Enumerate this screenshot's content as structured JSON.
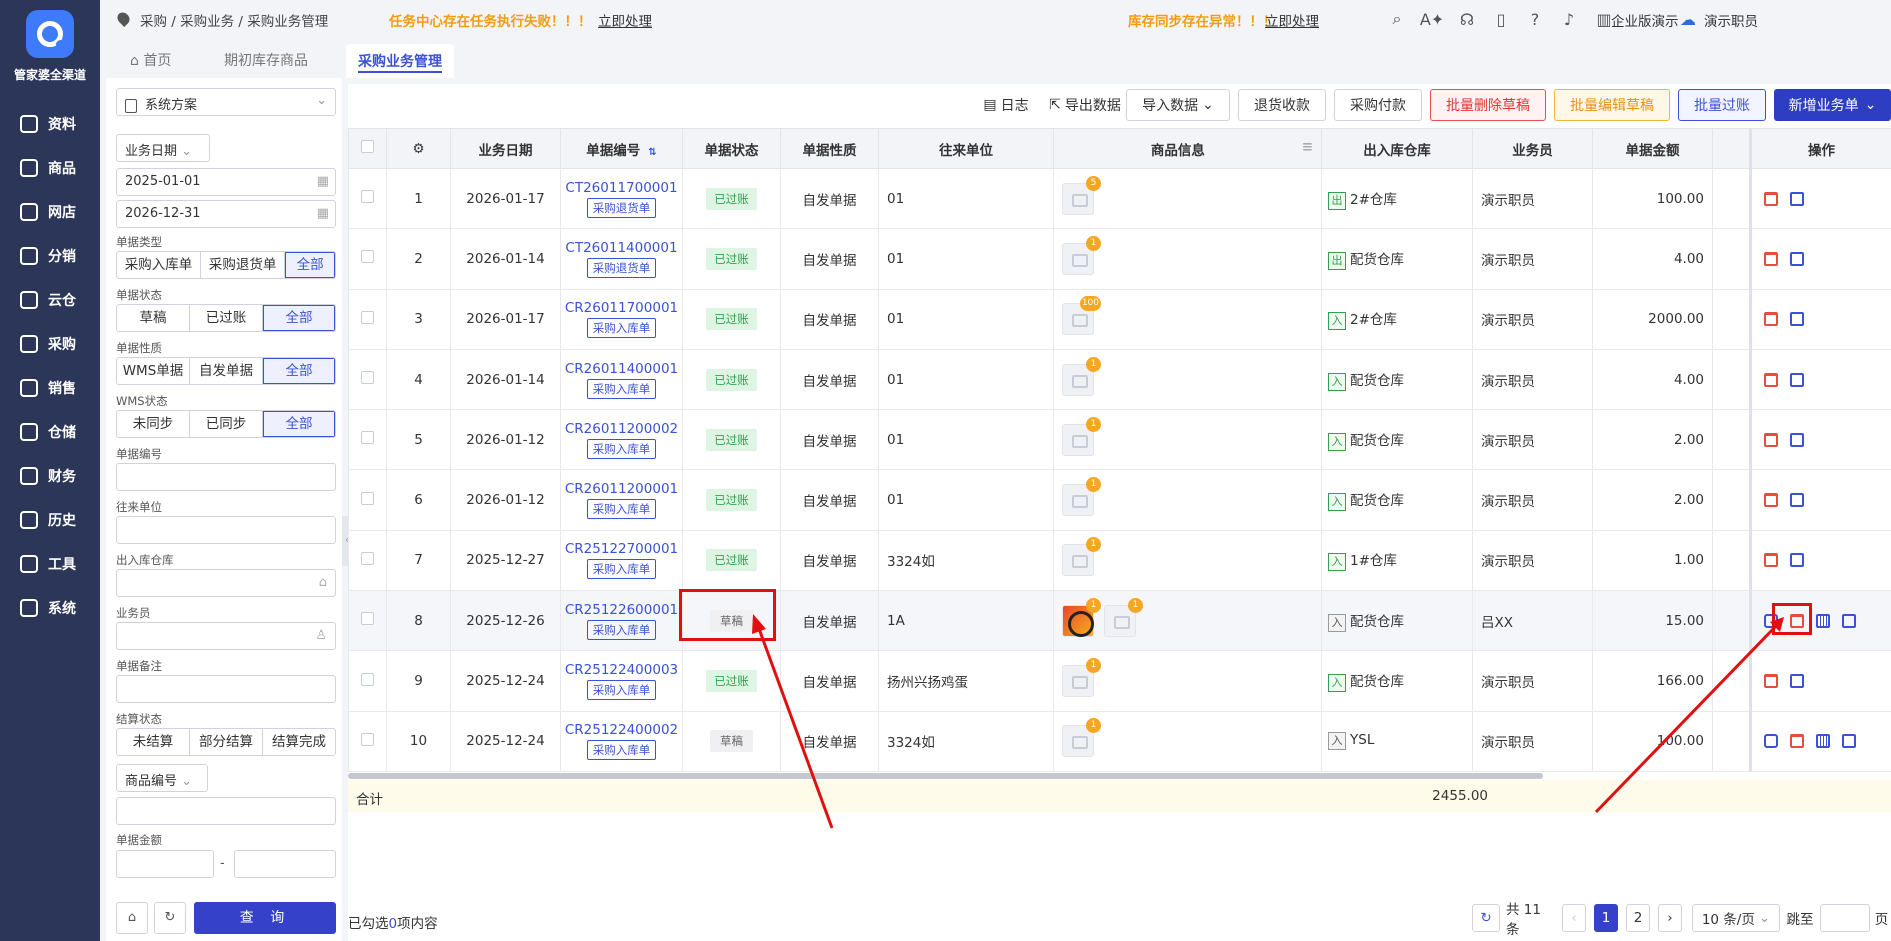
{
  "brand": "管家婆全渠道",
  "nav": [
    "资料",
    "商品",
    "网店",
    "分销",
    "云仓",
    "采购",
    "销售",
    "仓储",
    "财务",
    "历史",
    "工具",
    "系统"
  ],
  "topbar": {
    "breadcrumb": "采购 / 采购业务 / 采购业务管理",
    "warning1": "任务中心存在任务执行失败！！！",
    "warning1_link": "立即处理",
    "warning2": "库存同步存在异常！！！",
    "warning2_link": "立即处理",
    "edition": "企业版演示",
    "user": "演示职员"
  },
  "tabs": [
    "首页",
    "期初库存商品",
    "采购业务管理"
  ],
  "filter": {
    "scheme": "系统方案",
    "date_type": "业务日期",
    "date_from": "2025-01-01",
    "date_to": "2026-12-31",
    "doc_type_label": "单据类型",
    "doc_type_options": [
      "采购入库单",
      "采购退货单",
      "全部"
    ],
    "doc_status_label": "单据状态",
    "doc_status_options": [
      "草稿",
      "已过账",
      "全部"
    ],
    "doc_nature_label": "单据性质",
    "doc_nature_options": [
      "WMS单据",
      "自发单据",
      "全部"
    ],
    "wms_label": "WMS状态",
    "wms_options": [
      "未同步",
      "已同步",
      "全部"
    ],
    "doc_no_label": "单据编号",
    "partner_label": "往来单位",
    "warehouse_label": "出入库仓库",
    "staff_label": "业务员",
    "remark_label": "单据备注",
    "settle_label": "结算状态",
    "settle_options": [
      "未结算",
      "部分结算",
      "结算完成"
    ],
    "product_field": "商品编号",
    "amount_label": "单据金额",
    "amount_sep": "-",
    "query": "查 询"
  },
  "toolbar": {
    "log": "日志",
    "export": "导出数据",
    "import": "导入数据",
    "refund": "退货收款",
    "pay": "采购付款",
    "batch_delete": "批量删除草稿",
    "batch_edit": "批量编辑草稿",
    "batch_post": "批量过账",
    "add": "新增业务单"
  },
  "columns": [
    "业务日期",
    "单据编号",
    "单据状态",
    "单据性质",
    "往来单位",
    "商品信息",
    "出入库仓库",
    "业务员",
    "单据金额",
    "操作"
  ],
  "rows": [
    {
      "no": "1",
      "date": "2026-01-17",
      "doc": "CT26011700001",
      "type": "采购退货单",
      "status": "已过账",
      "nature": "自发单据",
      "partner": "01",
      "badge": "5",
      "wh_tag": "出",
      "warehouse": "2#仓库",
      "staff": "演示职员",
      "amount": "100.00"
    },
    {
      "no": "2",
      "date": "2026-01-14",
      "doc": "CT26011400001",
      "type": "采购退货单",
      "status": "已过账",
      "nature": "自发单据",
      "partner": "01",
      "badge": "1",
      "wh_tag": "出",
      "warehouse": "配货仓库",
      "staff": "演示职员",
      "amount": "4.00"
    },
    {
      "no": "3",
      "date": "2026-01-17",
      "doc": "CR26011700001",
      "type": "采购入库单",
      "status": "已过账",
      "nature": "自发单据",
      "partner": "01",
      "badge": "100",
      "wh_tag": "入",
      "warehouse": "2#仓库",
      "staff": "演示职员",
      "amount": "2000.00"
    },
    {
      "no": "4",
      "date": "2026-01-14",
      "doc": "CR26011400001",
      "type": "采购入库单",
      "status": "已过账",
      "nature": "自发单据",
      "partner": "01",
      "badge": "1",
      "wh_tag": "入",
      "warehouse": "配货仓库",
      "staff": "演示职员",
      "amount": "4.00"
    },
    {
      "no": "5",
      "date": "2026-01-12",
      "doc": "CR26011200002",
      "type": "采购入库单",
      "status": "已过账",
      "nature": "自发单据",
      "partner": "01",
      "badge": "1",
      "wh_tag": "入",
      "warehouse": "配货仓库",
      "staff": "演示职员",
      "amount": "2.00"
    },
    {
      "no": "6",
      "date": "2026-01-12",
      "doc": "CR26011200001",
      "type": "采购入库单",
      "status": "已过账",
      "nature": "自发单据",
      "partner": "01",
      "badge": "1",
      "wh_tag": "入",
      "warehouse": "配货仓库",
      "staff": "演示职员",
      "amount": "2.00"
    },
    {
      "no": "7",
      "date": "2025-12-27",
      "doc": "CR25122700001",
      "type": "采购入库单",
      "status": "已过账",
      "nature": "自发单据",
      "partner": "3324如",
      "badge": "1",
      "wh_tag": "入",
      "warehouse": "1#仓库",
      "staff": "演示职员",
      "amount": "1.00"
    },
    {
      "no": "8",
      "date": "2025-12-26",
      "doc": "CR25122600001",
      "type": "采购入库单",
      "status": "草稿",
      "nature": "自发单据",
      "partner": "1A",
      "badge": "1",
      "badge2": "1",
      "wh_tag": "入",
      "warehouse": "配货仓库",
      "staff": "吕XX",
      "amount": "15.00"
    },
    {
      "no": "9",
      "date": "2025-12-24",
      "doc": "CR25122400003",
      "type": "采购入库单",
      "status": "已过账",
      "nature": "自发单据",
      "partner": "扬州兴扬鸡蛋",
      "badge": "1",
      "wh_tag": "入",
      "warehouse": "配货仓库",
      "staff": "演示职员",
      "amount": "166.00"
    },
    {
      "no": "10",
      "date": "2025-12-24",
      "doc": "CR25122400002",
      "type": "采购入库单",
      "status": "草稿",
      "nature": "自发单据",
      "partner": "3324如",
      "badge": "1",
      "wh_tag": "入",
      "warehouse": "YSL",
      "staff": "演示职员",
      "amount": "100.00"
    }
  ],
  "summary": {
    "label": "合计",
    "amount": "2455.00"
  },
  "footer": {
    "selected_prefix": "已勾选",
    "selected_count": "0",
    "selected_suffix": "项内容",
    "total": "共 11 条",
    "page1": "1",
    "page2": "2",
    "page_size": "10 条/页",
    "goto": "跳至",
    "page_unit": "页"
  },
  "colors": {
    "accent": "#3b52d4",
    "nav_bg": "#2b3658",
    "annotation": "#e01010"
  }
}
